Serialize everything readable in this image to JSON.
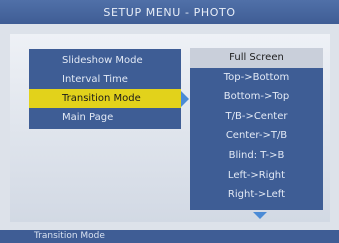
{
  "title": "SETUP MENU - PHOTO",
  "left_menu": {
    "items": [
      {
        "label": "Slideshow Mode"
      },
      {
        "label": "Interval Time"
      },
      {
        "label": "Transition Mode"
      },
      {
        "label": "Main Page"
      }
    ],
    "selected_index": 2
  },
  "right_menu": {
    "items": [
      {
        "label": "Full Screen"
      },
      {
        "label": "Top->Bottom"
      },
      {
        "label": "Bottom->Top"
      },
      {
        "label": "T/B->Center"
      },
      {
        "label": "Center->T/B"
      },
      {
        "label": "Blind: T->B"
      },
      {
        "label": "Left->Right"
      },
      {
        "label": "Right->Left"
      }
    ],
    "highlighted_index": 0
  },
  "status": {
    "text": "Transition Mode"
  },
  "icons": {
    "expand": "arrow-right-icon",
    "more": "arrow-down-icon"
  },
  "colors": {
    "panel": "#3e5d95",
    "selected": "#e2d21b",
    "highlight": "#c9cfda",
    "arrow": "#4b8bd6"
  }
}
